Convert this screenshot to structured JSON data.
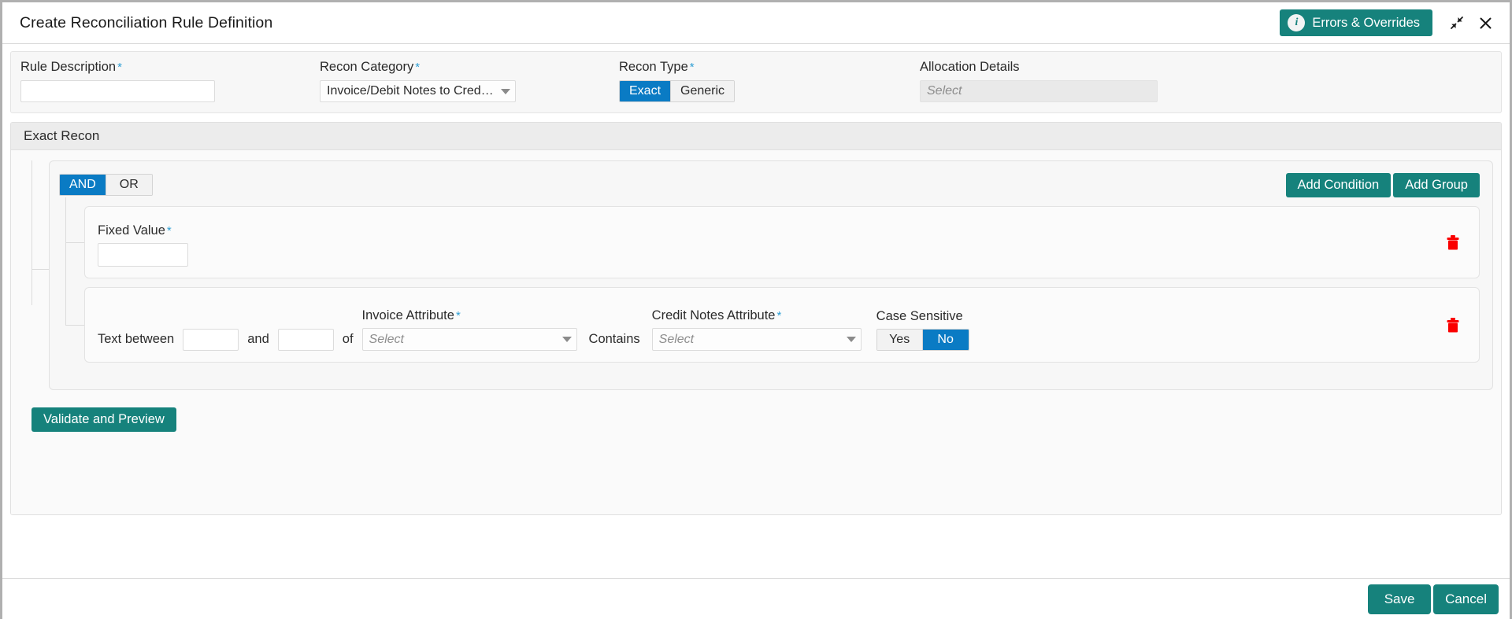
{
  "header": {
    "title": "Create Reconciliation Rule Definition",
    "errors_button": "Errors & Overrides",
    "info_glyph": "i",
    "collapse_title": "Restore",
    "close_title": "Close"
  },
  "colors": {
    "teal": "#16827c",
    "blue": "#0a7bc4",
    "required_asterisk": "#2e9fd4",
    "delete_red": "#fa0000"
  },
  "top_fields": {
    "rule_description": {
      "label": "Rule Description",
      "required": "*",
      "value": "",
      "placeholder": ""
    },
    "recon_category": {
      "label": "Recon Category",
      "required": "*",
      "value": "Invoice/Debit Notes to Credit No..."
    },
    "recon_type": {
      "label": "Recon Type",
      "required": "*",
      "options": [
        "Exact",
        "Generic"
      ],
      "selected": "Exact"
    },
    "allocation_details": {
      "label": "Allocation Details",
      "required": "",
      "placeholder": "Select",
      "value": ""
    }
  },
  "section": {
    "title": "Exact Recon",
    "logic_toggle": {
      "options": [
        "AND",
        "OR"
      ],
      "selected": "AND"
    },
    "add_condition_label": "Add Condition",
    "add_group_label": "Add Group",
    "conditions": [
      {
        "type": "fixed-value",
        "label": "Fixed Value",
        "required": "*",
        "value": ""
      },
      {
        "type": "text-between",
        "prefix": "Text between",
        "from_value": "",
        "conjunction": "and",
        "to_value": "",
        "of_word": "of",
        "invoice_attribute_label": "Invoice Attribute",
        "invoice_attribute_required": "*",
        "invoice_attribute_placeholder": "Select",
        "operator": "Contains",
        "credit_attribute_label": "Credit Notes Attribute",
        "credit_attribute_required": "*",
        "credit_attribute_placeholder": "Select",
        "case_sensitive_label": "Case Sensitive",
        "case_sensitive_options": [
          "Yes",
          "No"
        ],
        "case_sensitive_selected": "No"
      }
    ],
    "validate_button": "Validate and Preview"
  },
  "footer": {
    "save_label": "Save",
    "cancel_label": "Cancel"
  }
}
